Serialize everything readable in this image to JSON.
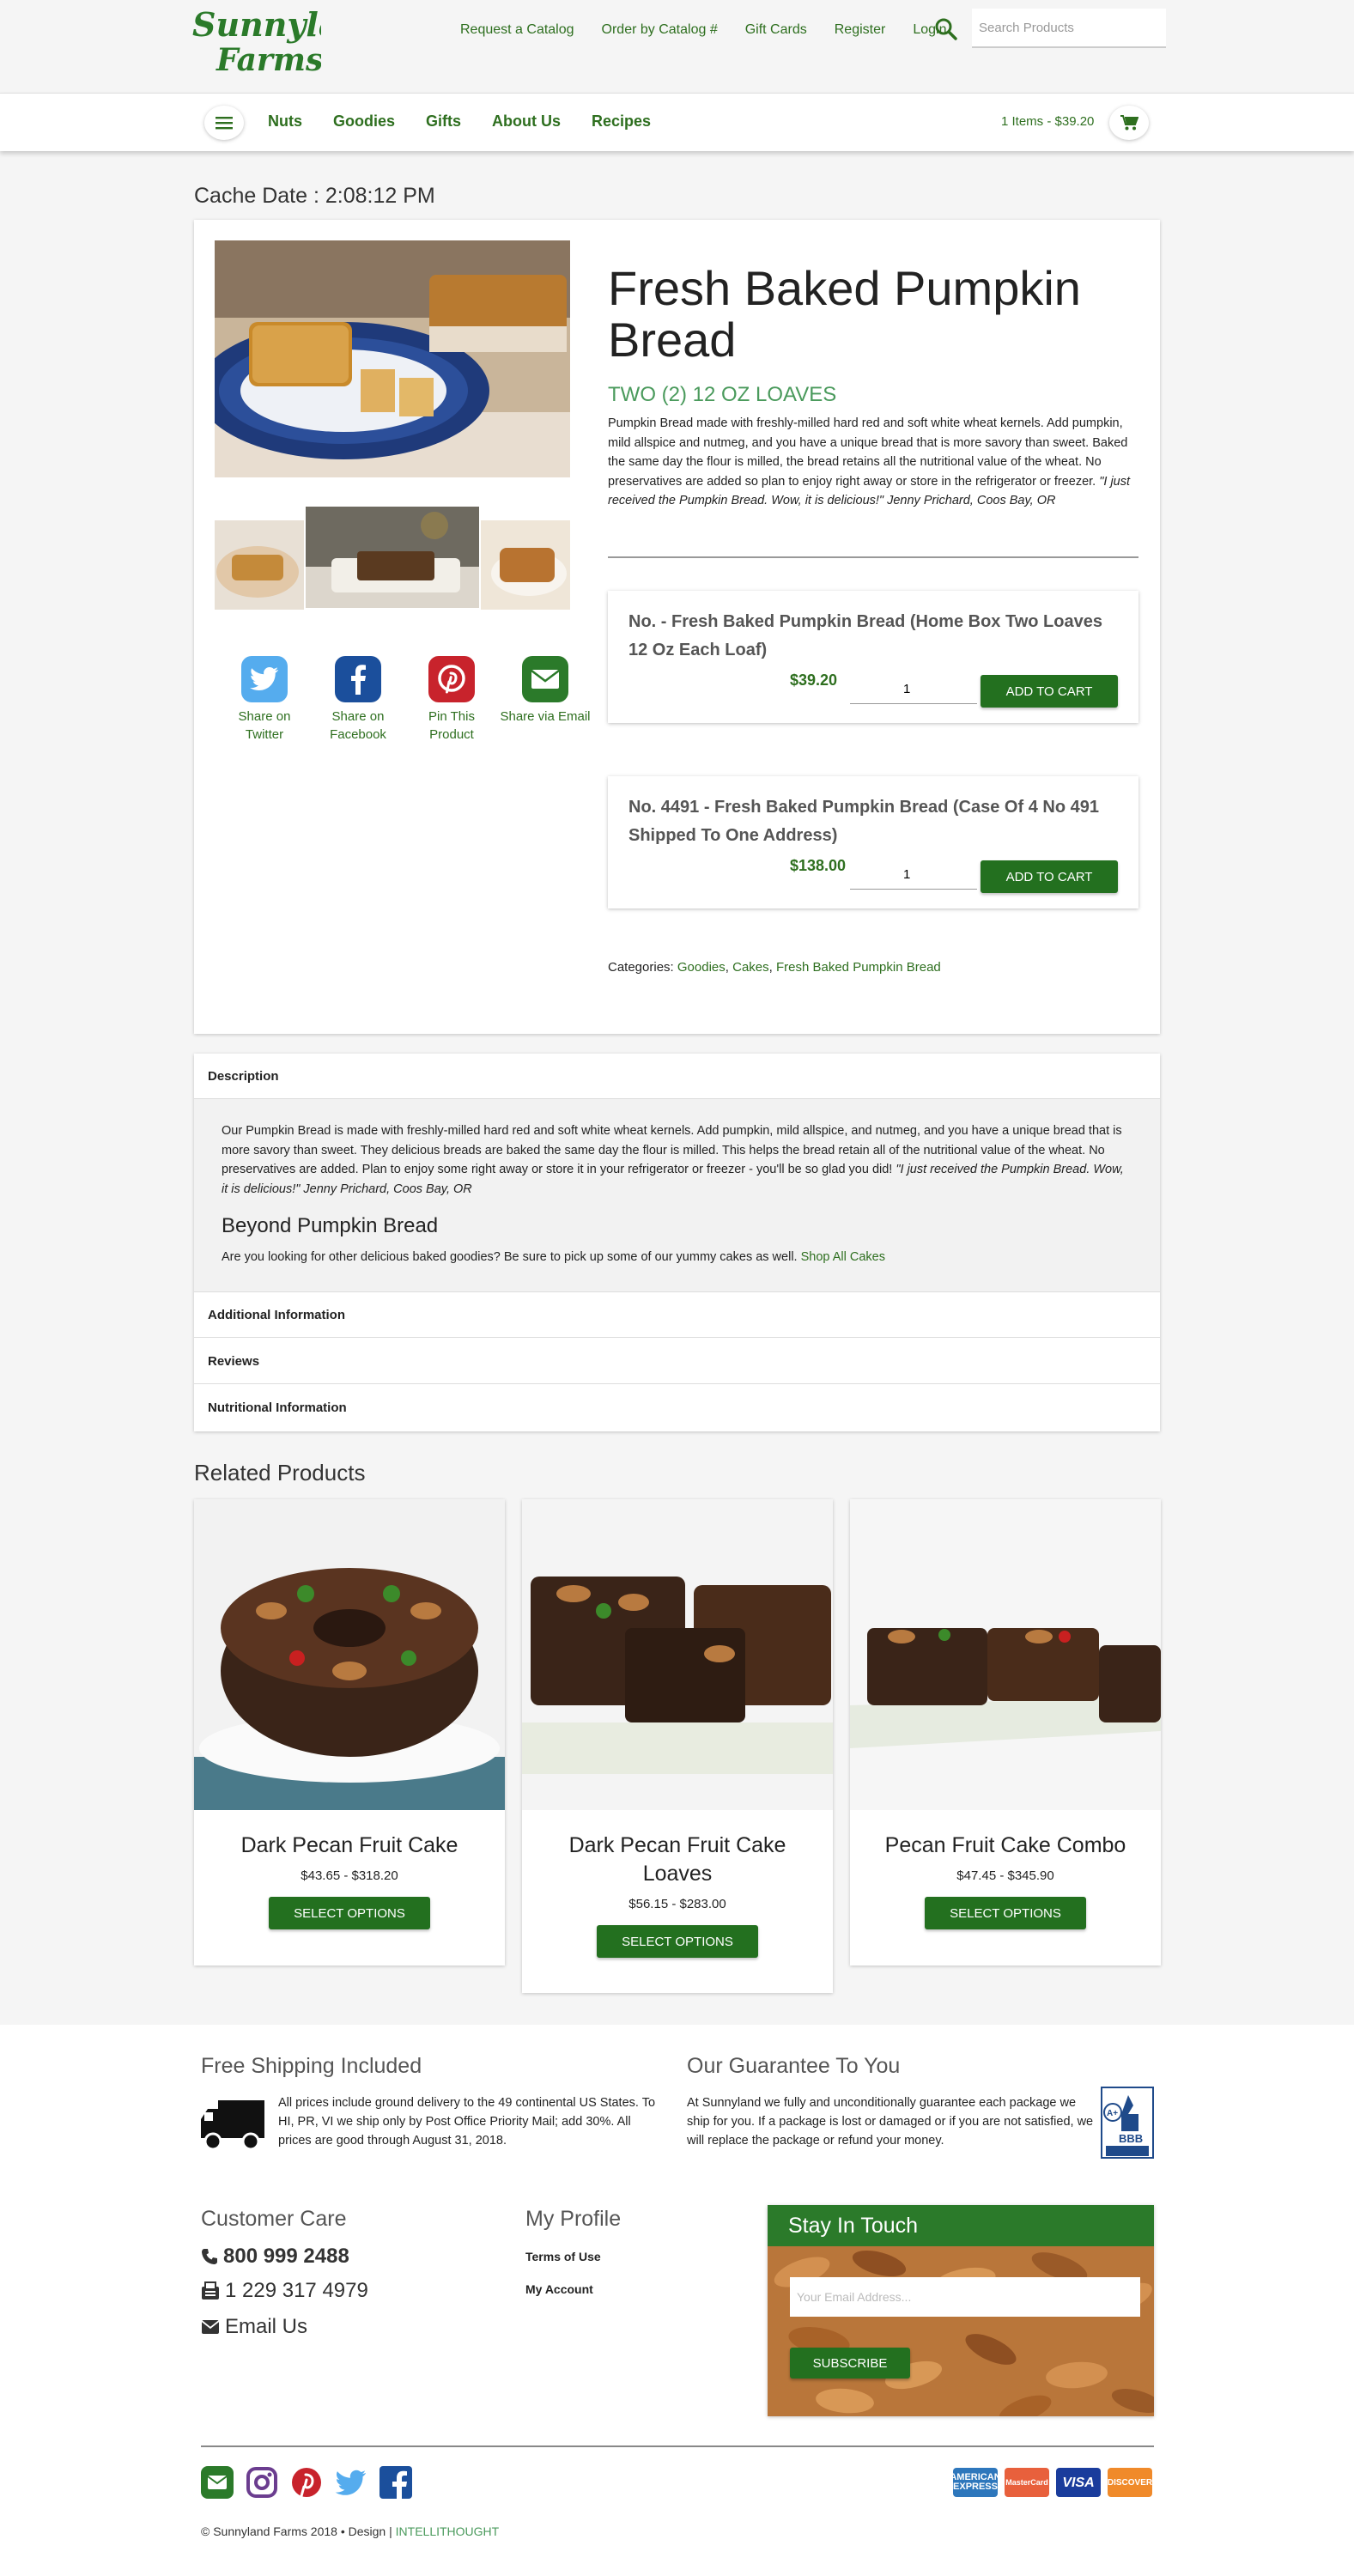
{
  "header": {
    "logo_text": "Sunnyland Farms",
    "top_links": [
      "Request a Catalog",
      "Order by Catalog #",
      "Gift Cards",
      "Register",
      "Login"
    ],
    "search_placeholder": "Search Products",
    "nav_items": [
      "Nuts",
      "Goodies",
      "Gifts",
      "About Us",
      "Recipes"
    ],
    "cart_summary": "1 Items - $39.20"
  },
  "cache_date": "Cache Date : 2:08:12 PM",
  "product": {
    "title": "Fresh Baked Pumpkin Bread",
    "subtitle": "TWO (2) 12 OZ LOAVES",
    "description": "Pumpkin Bread made with freshly-milled hard red and soft white wheat kernels. Add pumpkin, mild allspice and nutmeg, and you have a unique bread that is more savory than sweet. Baked the same day the flour is milled, the bread retains all the nutritional value of the wheat. No preservatives are added so plan to enjoy right away or store  in the refrigerator or freezer.",
    "description_quote": "\"I just received the Pumpkin Bread. Wow, it is delicious!\" Jenny Prichard, Coos Bay, OR",
    "share": [
      {
        "label": "Share on Twitter",
        "icon": "twitter-icon",
        "color": "#55acee"
      },
      {
        "label": "Share on Facebook",
        "icon": "facebook-icon",
        "color": "#1b4f9c"
      },
      {
        "label": "Pin This Product",
        "icon": "pinterest-icon",
        "color": "#c8232c"
      },
      {
        "label": "Share via Email",
        "icon": "email-icon",
        "color": "#2b7a2a"
      }
    ],
    "variants": [
      {
        "title": "No. - Fresh Baked Pumpkin Bread (Home Box Two Loaves 12 Oz Each Loaf)",
        "price": "$39.20",
        "qty": "1",
        "button": "ADD TO CART"
      },
      {
        "title": "No. 4491 - Fresh Baked Pumpkin Bread (Case Of 4 No 491 Shipped To One Address)",
        "price": "$138.00",
        "qty": "1",
        "button": "ADD TO CART"
      }
    ],
    "categories_label": "Categories:",
    "categories": [
      "Goodies",
      "Cakes",
      "Fresh Baked Pumpkin Bread"
    ]
  },
  "tabs": {
    "description_label": "Description",
    "description_text": "Our Pumpkin Bread is made with freshly-milled hard red and soft white wheat kernels. Add pumpkin, mild allspice, and nutmeg, and you have a unique bread that is more savory than sweet. They delicious breads are baked the same day the flour is milled. This helps the bread retain all of the nutritional value of the wheat. No preservatives are added. Plan to enjoy some right away or store it in your refrigerator or freezer - you'll be so glad you did!",
    "description_quote": "\"I just received the Pumpkin Bread. Wow, it is delicious!\" Jenny Prichard, Coos Bay, OR",
    "beyond_heading": "Beyond Pumpkin Bread",
    "beyond_text": "Are you looking for other delicious baked goodies? Be sure to pick up some of our yummy cakes as well.",
    "beyond_link": "Shop All Cakes",
    "additional_label": "Additional Information",
    "reviews_label": "Reviews",
    "nutrition_label": "Nutritional Information"
  },
  "related": {
    "title": "Related Products",
    "items": [
      {
        "name": "Dark Pecan Fruit Cake",
        "price": "$43.65 - $318.20",
        "button": "SELECT OPTIONS"
      },
      {
        "name": "Dark Pecan Fruit Cake Loaves",
        "price": "$56.15 - $283.00",
        "button": "SELECT OPTIONS"
      },
      {
        "name": "Pecan Fruit Cake Combo",
        "price": "$47.45 - $345.90",
        "button": "SELECT OPTIONS"
      }
    ]
  },
  "footer": {
    "shipping_heading": "Free Shipping Included",
    "shipping_text": "All prices include ground delivery to the 49 continental US States. To HI, PR, VI we ship only by Post Office Priority Mail; add 30%. All prices are good through August 31, 2018.",
    "guarantee_heading": "Our Guarantee To You",
    "guarantee_text": "At Sunnyland we fully and unconditionally guarantee each package we ship for you. If a package is lost or damaged or if you are not satisfied, we will replace the package or refund your money.",
    "customer_care_heading": "Customer Care",
    "phone": "800 999 2488",
    "fax": "1 229 317 4979",
    "email": "Email Us",
    "profile_heading": "My Profile",
    "terms": "Terms of Use",
    "account": "My Account",
    "stay_heading": "Stay In Touch",
    "email_placeholder": "Your Email Address...",
    "subscribe": "SUBSCRIBE",
    "bbb_text": "A+ BBB ACCREDITED BUSINESS",
    "payments": [
      "AMERICAN EXPRESS",
      "MasterCard",
      "VISA",
      "DISCOVER"
    ],
    "copyright": "© Sunnyland Farms 2018 • Design |",
    "designer": "INTELLITHOUGHT"
  },
  "colors": {
    "brand_green": "#2e6f1f",
    "button_green": "#23701f",
    "subtitle_green": "#4a9a5c"
  }
}
